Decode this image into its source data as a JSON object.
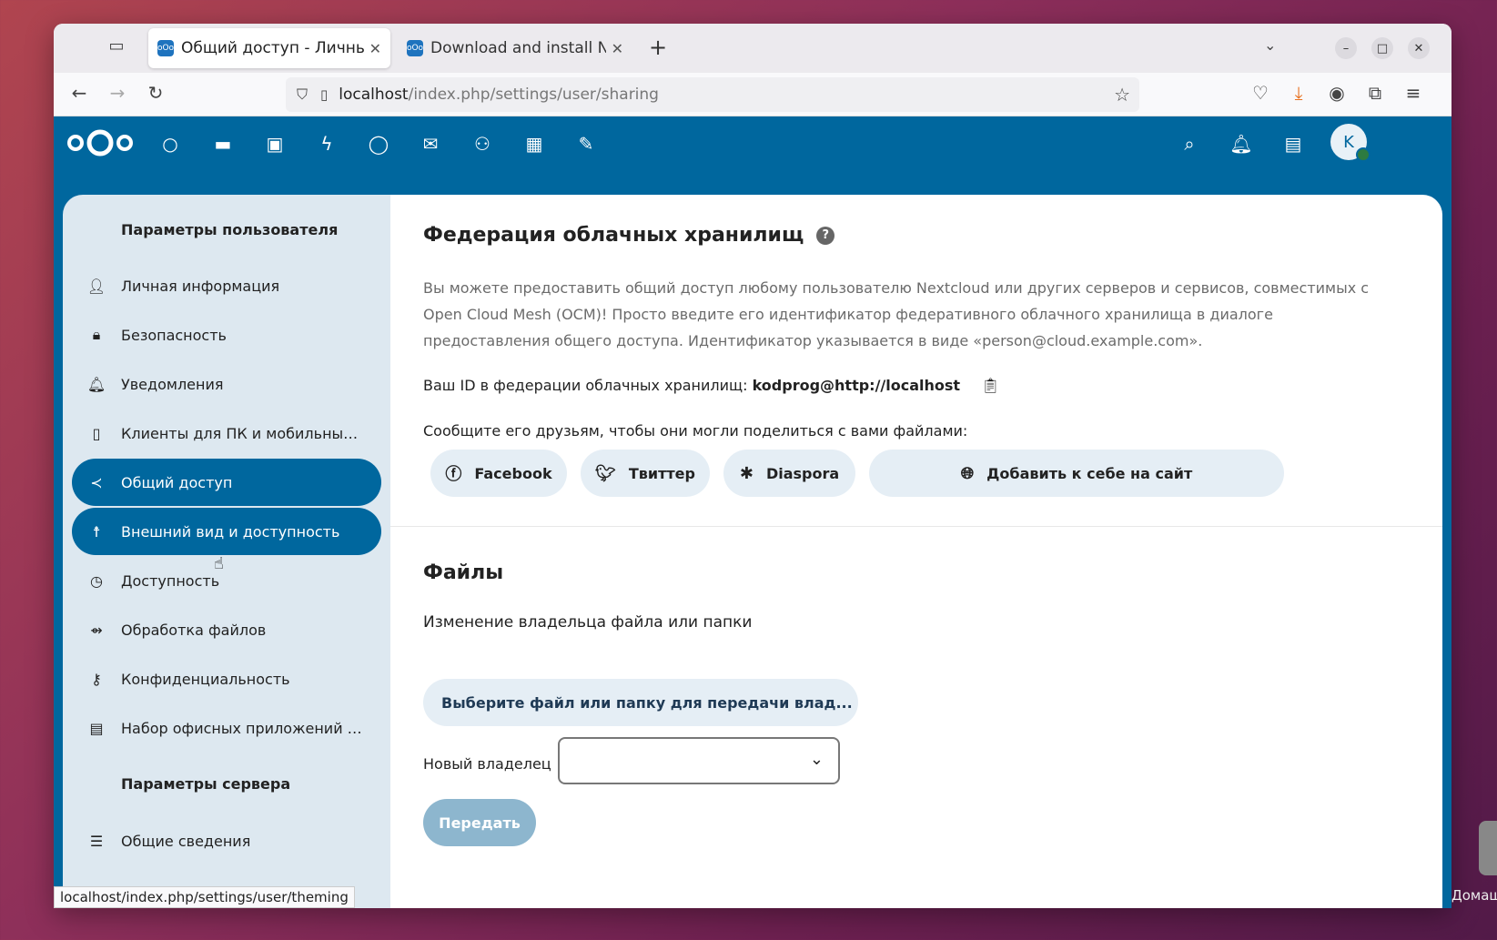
{
  "browser": {
    "tabs": [
      {
        "title": "Общий доступ - Личные",
        "active": true
      },
      {
        "title": "Download and install Ne",
        "active": false
      }
    ],
    "url_host": "localhost",
    "url_path": "/index.php/settings/user/sharing",
    "status_url": "localhost/index.php/settings/user/theming"
  },
  "header": {
    "avatar_letter": "K",
    "apps": [
      "dashboard-icon",
      "files-icon",
      "photos-icon",
      "activity-icon",
      "talk-icon",
      "mail-icon",
      "contacts-icon",
      "calendar-icon",
      "notes-icon"
    ]
  },
  "sidebar": {
    "user_caption": "Параметры пользователя",
    "items": [
      {
        "label": "Личная информация",
        "icon": "person-icon"
      },
      {
        "label": "Безопасность",
        "icon": "lock-icon"
      },
      {
        "label": "Уведомления",
        "icon": "bell-icon"
      },
      {
        "label": "Клиенты для ПК и мобильны…",
        "icon": "phone-icon"
      },
      {
        "label": "Общий доступ",
        "icon": "share-icon",
        "active": true
      },
      {
        "label": "Внешний вид и доступность",
        "icon": "accessibility-icon",
        "active": true
      },
      {
        "label": "Доступность",
        "icon": "clock-icon"
      },
      {
        "label": "Обработка файлов",
        "icon": "workflow-icon"
      },
      {
        "label": "Конфиденциальность",
        "icon": "key-icon"
      },
      {
        "label": "Набор офисных приложений …",
        "icon": "document-icon"
      }
    ],
    "server_caption": "Параметры сервера",
    "server_items": [
      {
        "label": "Общие сведения",
        "icon": "list-icon"
      }
    ]
  },
  "federation": {
    "title": "Федерация облачных хранилищ",
    "description": "Вы можете предоставить общий доступ любому пользователю Nextcloud или других серверов и сервисов, совместимых с Open Cloud Mesh (OCM)! Просто введите его идентификатор федеративного облачного хранилища в диалоге предоставления общего доступа. Идентификатор указывается в виде «person@cloud.example.com».",
    "id_label": "Ваш ID в федерации облачных хранилищ:",
    "id_value": "kodprog@http://localhost",
    "tell_friends": "Сообщите его друзьям, чтобы они могли поделиться с вами файлами:",
    "buttons": {
      "facebook": "Facebook",
      "twitter": "Твиттер",
      "diaspora": "Diaspora",
      "add_site": "Добавить к себе на сайт"
    }
  },
  "files": {
    "title": "Файлы",
    "subtitle": "Изменение владельца файла или папки",
    "pick_button": "Выберите файл или папку для передачи влад...",
    "owner_label": "Новый владелец",
    "owner_value": "",
    "submit": "Передать"
  },
  "desktop": {
    "label": "Домаш"
  },
  "colors": {
    "brand": "#00679e",
    "sidebar_bg": "#dde8f0",
    "button_bg": "#e5eef5"
  }
}
